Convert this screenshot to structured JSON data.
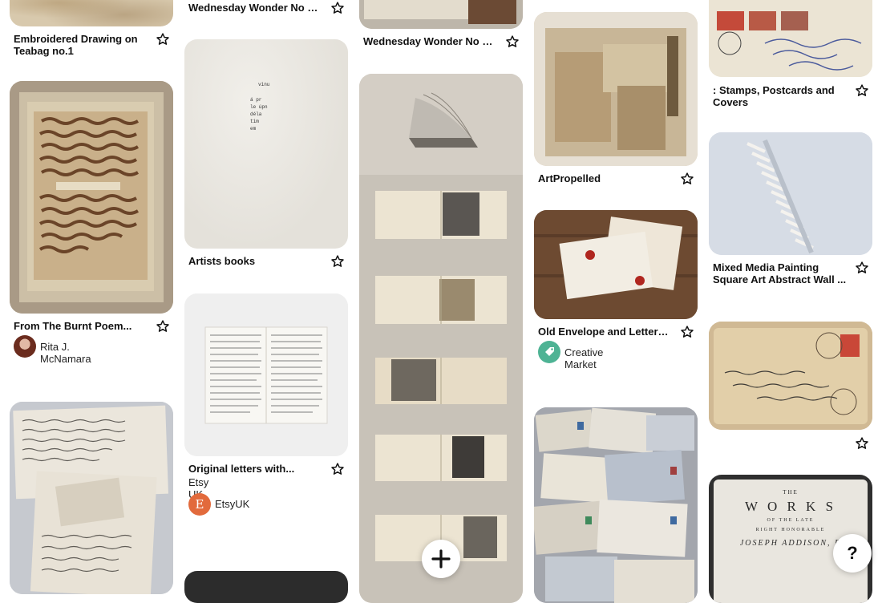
{
  "pins": [
    {
      "key": "embroidered",
      "title": "Embroidered Drawing on Teabag no.1"
    },
    {
      "key": "burnt",
      "title": "From The Burnt Poem...",
      "source_name": "Rita J. McNamara"
    },
    {
      "key": "wonder1",
      "title": "Wednesday Wonder No 6...."
    },
    {
      "key": "artists",
      "title": "Artists books"
    },
    {
      "key": "letters",
      "title": "Original letters with...",
      "subtitle": "Etsy UK",
      "source_name": "EtsyUK",
      "avatar_letter": "E"
    },
    {
      "key": "wonder2",
      "title": "Wednesday Wonder No 6...."
    },
    {
      "key": "artpropelled",
      "title": "ArtPropelled"
    },
    {
      "key": "envelope",
      "title": "Old Envelope and Letter o...",
      "source_name": "Creative Market"
    },
    {
      "key": "stamps",
      "title": ": Stamps, Postcards and Covers"
    },
    {
      "key": "mixed",
      "title": "Mixed Media Painting Square Art Abstract Wall ..."
    }
  ],
  "artists_book_text": [
    "vinu",
    "á pr",
    "le úpn",
    "déla",
    "tim",
    "em"
  ],
  "works_title": {
    "line1": "THE",
    "line2": "W O R K S",
    "line3": "OF THE LATE",
    "line4": "RIGHT HONORABLE",
    "line5": "JOSEPH ADDISON, E"
  },
  "floating": {
    "add_symbol": "+",
    "help_symbol": "?"
  }
}
